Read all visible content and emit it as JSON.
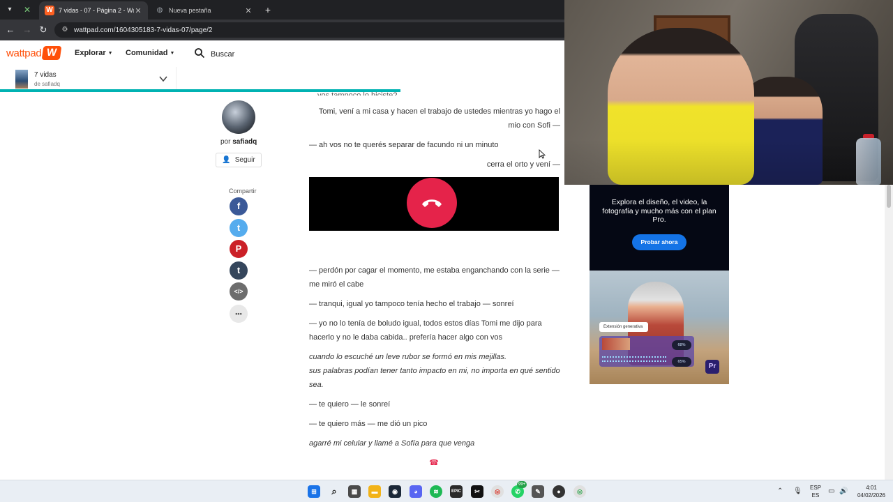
{
  "browser": {
    "tabs": [
      {
        "title": "7 vidas - 07 - Página 2 - Wattp",
        "active": true
      },
      {
        "title": "Nueva pestaña",
        "active": false
      }
    ],
    "new_tab": "+",
    "url": "wattpad.com/1604305183-7-vidas-07/page/2"
  },
  "header": {
    "logo": "wattpad",
    "logo_mark": "W",
    "explore": "Explorar",
    "community": "Comunidad",
    "search": "Buscar"
  },
  "story": {
    "title": "7 vidas",
    "author_line": "de safiadq",
    "reading_progress": 0.71
  },
  "sidebar": {
    "by_prefix": "por",
    "author": "safiadq",
    "follow": "Seguir",
    "share_label": "Compartir",
    "share": [
      {
        "icon": "facebook-icon",
        "glyph": "f",
        "color": "#3b5998"
      },
      {
        "icon": "twitter-icon",
        "glyph": "t",
        "color": "#55acee"
      },
      {
        "icon": "pinterest-icon",
        "glyph": "P",
        "color": "#cb2027"
      },
      {
        "icon": "tumblr-icon",
        "glyph": "t",
        "color": "#35465c"
      },
      {
        "icon": "embed-icon",
        "glyph": "</>",
        "color": "#6d6d6d"
      },
      {
        "icon": "more-icon",
        "glyph": "•••",
        "color": "#e8e8e8"
      }
    ]
  },
  "content": {
    "partial_line": "vos tampoco lo hiciste?",
    "p1": "Tomi, vení a mi casa y hacen el trabajo de ustedes mientras yo hago el mio con Sofi —",
    "p2": "— ah vos no te querés separar de facundo ni un minuto",
    "p3": "cerra el orto y vení —",
    "p4": "— perdón por cagar el momento, me estaba enganchando con la serie — me miró el cabe",
    "p5": "— tranqui, igual yo tampoco tenía hecho el trabajo — sonreí",
    "p6": "— yo no lo tenía de boludo igual, todos estos días Tomi me dijo para hacerlo y no le daba cabida.. prefería hacer algo con vos",
    "p7": "cuando lo escuché un leve rubor se formó en mis mejillas.",
    "p8": "sus palabras podían tener tanto impacto en mi, no importa en qué sentido sea.",
    "p9": "— te quiero — le sonreí",
    "p10": "— te quiero más — me dió un pico",
    "p11": "agarré mi celular y llamé a Sofía para que venga",
    "phone_emoji": "☎"
  },
  "ad": {
    "text": "Explora el diseño, el video, la fotografía y mucho más con el plan Pro.",
    "cta": "Probar ahora",
    "chip": "Extensión generativa",
    "percent_1": "68%",
    "percent_2": "65%",
    "app_badge": "Pr"
  },
  "taskbar": {
    "badge_whatsapp": "99+",
    "lang_top": "ESP",
    "lang_bottom": "ES",
    "time": "4:01",
    "date": "04/02/2026"
  },
  "colors": {
    "wattpad_orange": "#ff500a",
    "accent_teal": "#00b2b2",
    "call_red": "#e5234a",
    "adobe_blue": "#1473e6"
  }
}
